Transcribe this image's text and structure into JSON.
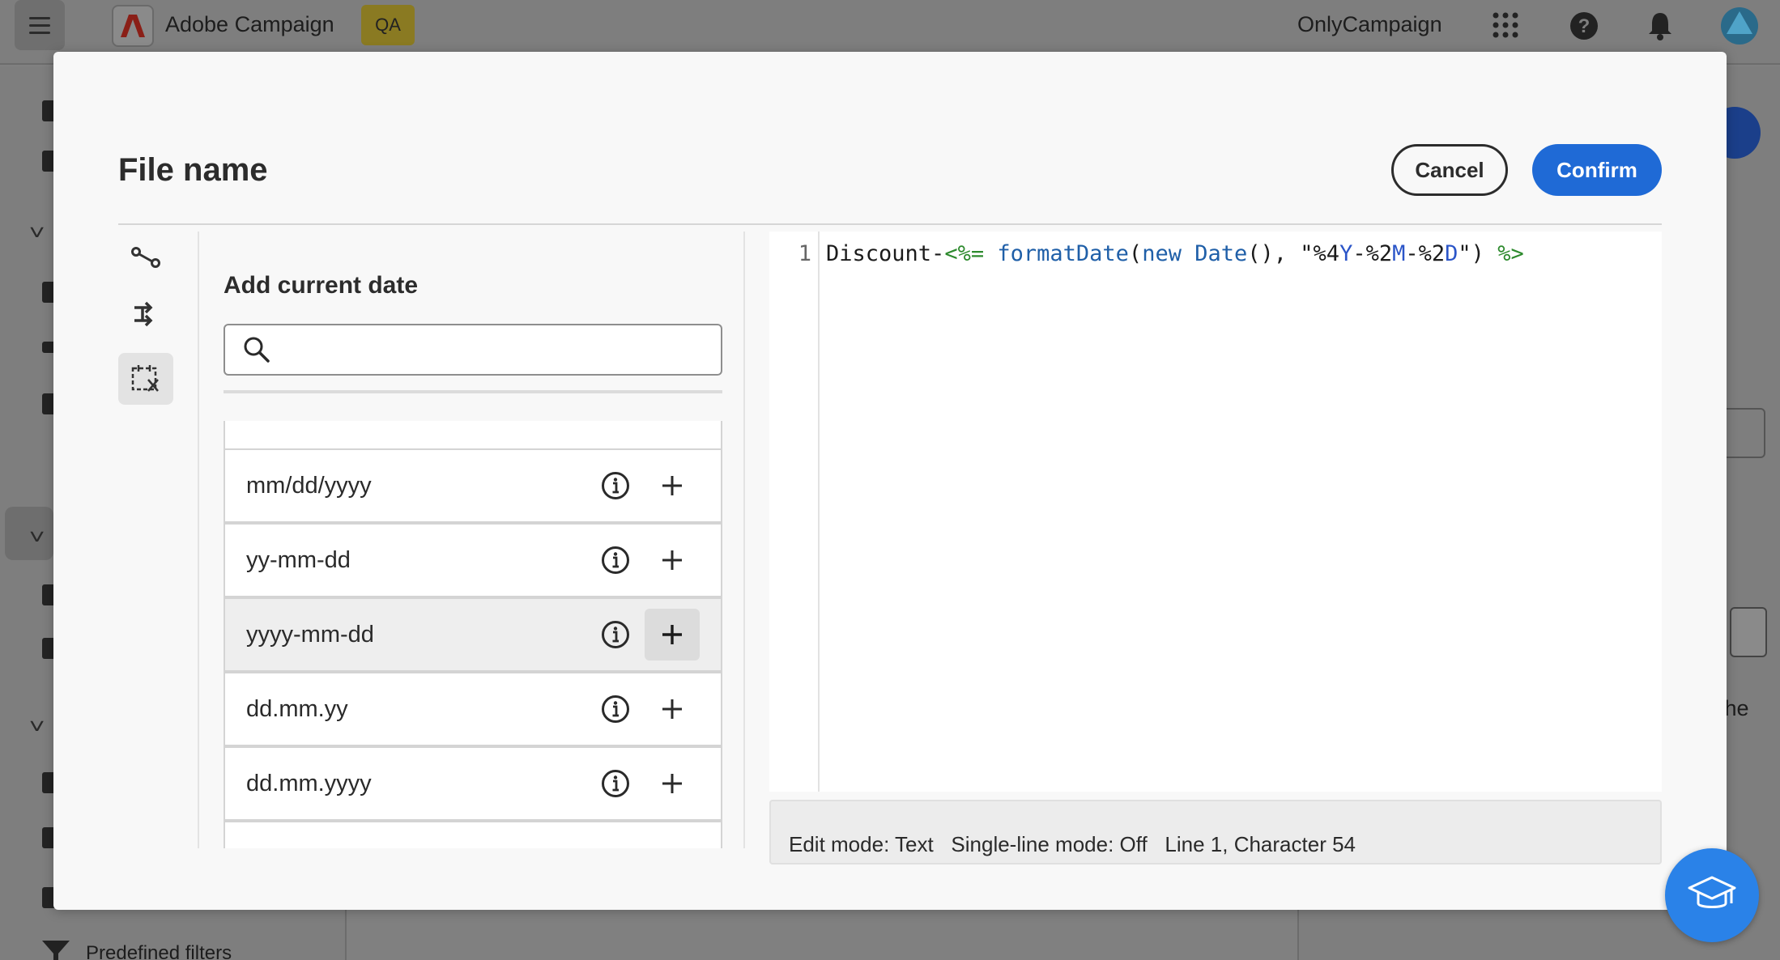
{
  "app": {
    "title": "Adobe Campaign",
    "env_badge": "QA",
    "org_name": "OnlyCampaign",
    "sidebar_bottom_label": "Predefined filters",
    "right_panel_snippet": "the"
  },
  "modal": {
    "title": "File name",
    "cancel_label": "Cancel",
    "confirm_label": "Confirm",
    "panel_title": "Add current date",
    "search": {
      "value": "",
      "placeholder": ""
    },
    "date_formats": [
      {
        "label": "mm/dd/yyyy"
      },
      {
        "label": "yy-mm-dd"
      },
      {
        "label": "yyyy-mm-dd"
      },
      {
        "label": "dd.mm.yy"
      },
      {
        "label": "dd.mm.yyyy"
      }
    ],
    "highlighted_format": "yyyy-mm-dd",
    "editor": {
      "line_number": "1",
      "code_parts": {
        "prefix": "Discount-",
        "open_tag": "<%=",
        "fn": "formatDate",
        "paren_open": "(",
        "kw_new": "new",
        "kw_date": "Date",
        "args_mid": "(), \"%4",
        "y": "Y",
        "dash1": "-%2",
        "m": "M",
        "dash2": "-%2",
        "d": "D",
        "close_args": "\")",
        "close_tag": "%>"
      }
    },
    "status_bar": {
      "edit_mode": "Edit mode: Text",
      "single_line": "Single-line mode: Off",
      "position": "Line 1, Character 54"
    }
  },
  "colors": {
    "accent": "#1f6ad6",
    "help_fab": "#2a82e8",
    "code_tag": "#2d8a2d",
    "code_keyword": "#1f5fa8"
  },
  "icons": {
    "rail": [
      "path-icon",
      "branch-icon",
      "calendar-variable-icon"
    ],
    "search": "search-icon",
    "info": "info-icon",
    "add": "plus-icon",
    "help": "graduation-cap-icon"
  }
}
